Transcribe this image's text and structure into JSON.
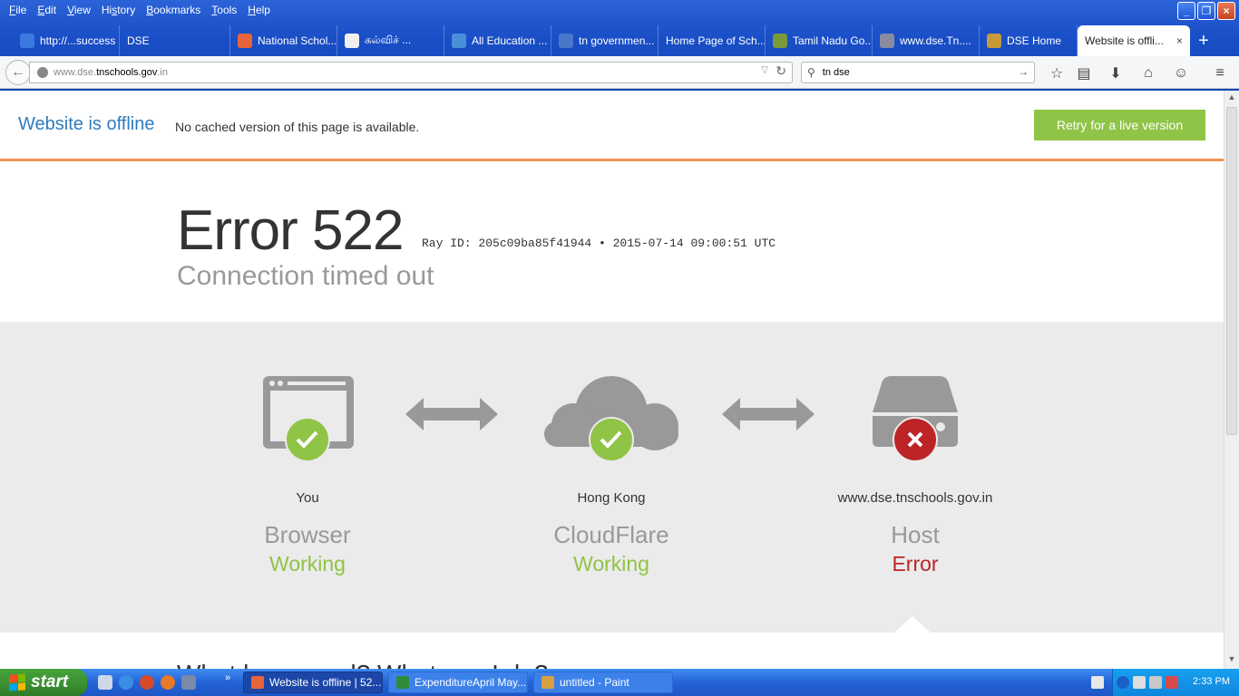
{
  "menubar": {
    "items": [
      {
        "pre": "",
        "u": "F",
        "post": "ile"
      },
      {
        "pre": "",
        "u": "E",
        "post": "dit"
      },
      {
        "pre": "",
        "u": "V",
        "post": "iew"
      },
      {
        "pre": "Hi",
        "u": "s",
        "post": "tory"
      },
      {
        "pre": "",
        "u": "B",
        "post": "ookmarks"
      },
      {
        "pre": "",
        "u": "T",
        "post": "ools"
      },
      {
        "pre": "",
        "u": "H",
        "post": "elp"
      }
    ]
  },
  "tabs": [
    {
      "label": "http://...success",
      "color": "#3a7ae0"
    },
    {
      "label": "DSE",
      "color": ""
    },
    {
      "label": "National Schol...",
      "color": "#e8643a"
    },
    {
      "label": "கல்விச் ...",
      "color": "#f0f0f0"
    },
    {
      "label": "All Education ...",
      "color": "#4a90d9"
    },
    {
      "label": "tn governmen...",
      "color": "#4a78c8"
    },
    {
      "label": "Home Page of Sch...",
      "color": ""
    },
    {
      "label": "Tamil Nadu Go...",
      "color": "#7a9a3a"
    },
    {
      "label": "www.dse.Tn....",
      "color": "#8a8aa0"
    },
    {
      "label": "DSE Home",
      "color": "#c89a3a"
    },
    {
      "label": "Website is offli...",
      "color": "",
      "active": true
    }
  ],
  "tab_close": "×",
  "new_tab": "+",
  "url": {
    "prefix": "www.dse.",
    "domain": "tnschools.gov.in",
    "suffix": ".in"
  },
  "search": {
    "value": "tn dse"
  },
  "banner": {
    "title": "Website is offline",
    "subtitle": "No cached version of this page is available.",
    "retry": "Retry for a live version"
  },
  "error": {
    "code": "Error 522",
    "ray": "Ray ID: 205c09ba85f41944 • 2015-07-14 09:00:51 UTC",
    "desc": "Connection timed out"
  },
  "status": {
    "browser": {
      "location": "You",
      "title": "Browser",
      "state": "Working"
    },
    "cloudflare": {
      "location": "Hong Kong",
      "title": "CloudFlare",
      "state": "Working"
    },
    "host": {
      "location": "www.dse.tnschools.gov.in",
      "title": "Host",
      "state": "Error"
    }
  },
  "below": {
    "text": "What happened?                                What can I do?"
  },
  "colors": {
    "ok": "#8fc446",
    "error": "#bd2426",
    "accent": "#2f7bbf",
    "banner_border": "#f1944f"
  },
  "taskbar": {
    "start": "start",
    "tasks": [
      {
        "label": "Website is offline | 52...",
        "color": "#e8643a",
        "active": true
      },
      {
        "label": "ExpenditureApril May....",
        "color": "#2e8b3a",
        "active": false
      },
      {
        "label": "untitled - Paint",
        "color": "#d8a040",
        "active": false
      }
    ],
    "clock": "2:33 PM"
  }
}
